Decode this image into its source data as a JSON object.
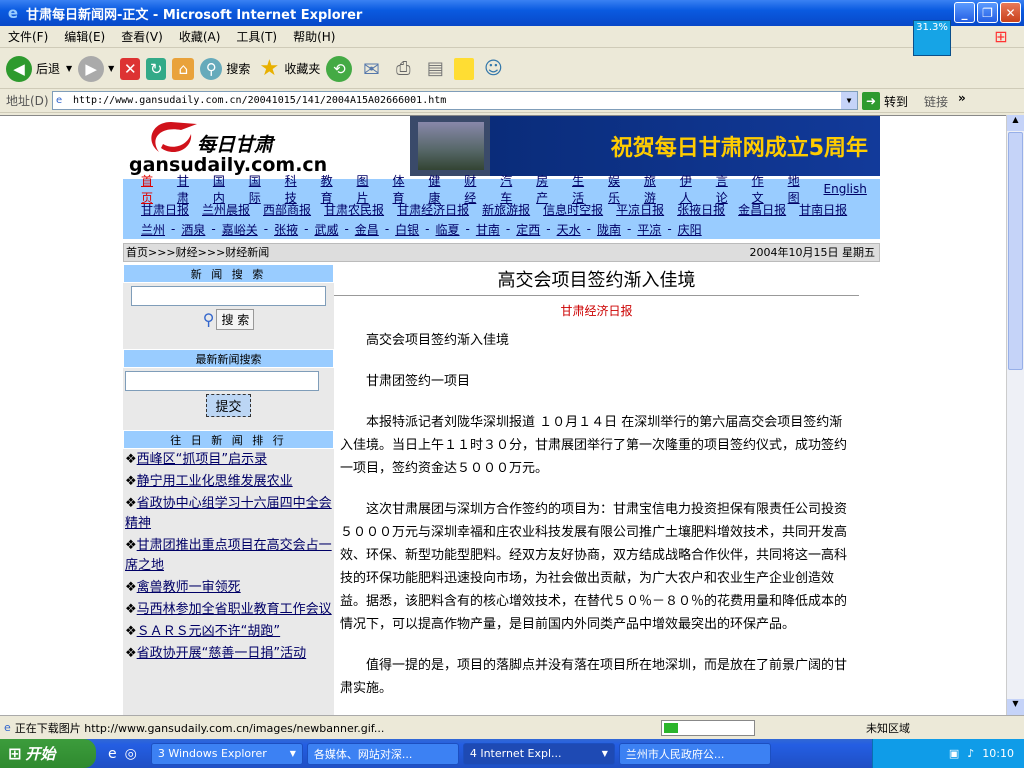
{
  "window": {
    "title": "甘肃每日新闻网-正文 - Microsoft Internet Explorer",
    "percent": "31.3%"
  },
  "menu": [
    "文件(F)",
    "编辑(E)",
    "查看(V)",
    "收藏(A)",
    "工具(T)",
    "帮助(H)"
  ],
  "toolbar": {
    "back": "后退",
    "search": "搜索",
    "favorites": "收藏夹"
  },
  "address": {
    "label": "地址(D)",
    "url": "http://www.gansudaily.com.cn/20041015/141/2004A15A02666001.htm",
    "go": "转到",
    "links": "链接"
  },
  "site": {
    "logo_cn": "每日甘肃",
    "logo_en": "gansudaily.com.cn",
    "banner": "祝贺每日甘肃网成立5周年",
    "nav_row1": [
      "首页",
      "甘肃",
      "国内",
      "国际",
      "科技",
      "教育",
      "图片",
      "体育",
      "健康",
      "财经",
      "汽车",
      "房产",
      "生活",
      "娱乐",
      "旅游",
      "伊人",
      "言论",
      "作文",
      "地图",
      "English"
    ],
    "nav_row2": [
      "甘肃日报",
      "兰州晨报",
      "西部商报",
      "甘肃农民报",
      "甘肃经济日报",
      "新旅游报",
      "信息时空报",
      "平凉日报",
      "张掖日报",
      "金昌日报",
      "甘南日报"
    ],
    "nav_row3": [
      "兰州",
      "酒泉",
      "嘉峪关",
      "张掖",
      "武威",
      "金昌",
      "白银",
      "临夏",
      "甘南",
      "定西",
      "天水",
      "陇南",
      "平凉",
      "庆阳"
    ],
    "breadcrumb": "首页>>>财经>>>财经新闻",
    "date": "2004年10月15日 星期五"
  },
  "left": {
    "search_title": "新 闻 搜 索",
    "search_btn": "搜 索",
    "latest_title": "最新新闻搜索",
    "submit_btn": "提交",
    "rank_title": "往 日 新 闻 排 行",
    "rank_items": [
      "西峰区“抓项目”启示录",
      "静宁用工业化思维发展农业",
      "省政协中心组学习十六届四中全会精神",
      "甘肃团推出重点项目在高交会占一席之地",
      "禽兽教师一审领死",
      "马西林参加全省职业教育工作会议",
      "ＳＡＲＳ元凶不许“胡跑”",
      "省政协开展“慈善一日捐”活动"
    ]
  },
  "article": {
    "title": "高交会项目签约渐入佳境",
    "source": "甘肃经济日报",
    "p1": "高交会项目签约渐入佳境",
    "p2": "甘肃团签约一项目",
    "p3": "本报特派记者刘陇华深圳报道 １０月１４日 在深圳举行的第六届高交会项目签约渐入佳境。当日上午１１时３０分，甘肃展团举行了第一次隆重的项目签约仪式，成功签约一项目，签约资金达５０００万元。",
    "p4": "这次甘肃展团与深圳方合作签约的项目为：甘肃宝信电力投资担保有限责任公司投资５０００万元与深圳幸福和庄农业科技发展有限公司推广土壤肥料增效技术，共同开发高效、环保、新型功能型肥料。经双方友好协商，双方结成战略合作伙伴，共同将这一高科技的环保功能肥料迅速投向市场，为社会做出贡献，为广大农户和农业生产企业创造效益。据悉，该肥料含有的核心增效技术，在替代５０％－８０％的花费用量和降低成本的情况下，可以提高作物产量，是目前国内外同类产品中增效最突出的环保产品。",
    "p5": "值得一提的是，项目的落脚点并没有落在项目所在地深圳，而是放在了前景广阔的甘肃实施。"
  },
  "status": {
    "text": "正在下载图片 http://www.gansudaily.com.cn/images/newbanner.gif...",
    "zone": "未知区域"
  },
  "taskbar": {
    "start": "开始",
    "tasks": [
      "3 Windows Explorer",
      "各媒体、网站对深...",
      "4 Internet Expl...",
      "兰州市人民政府公..."
    ],
    "clock": "10:10"
  }
}
